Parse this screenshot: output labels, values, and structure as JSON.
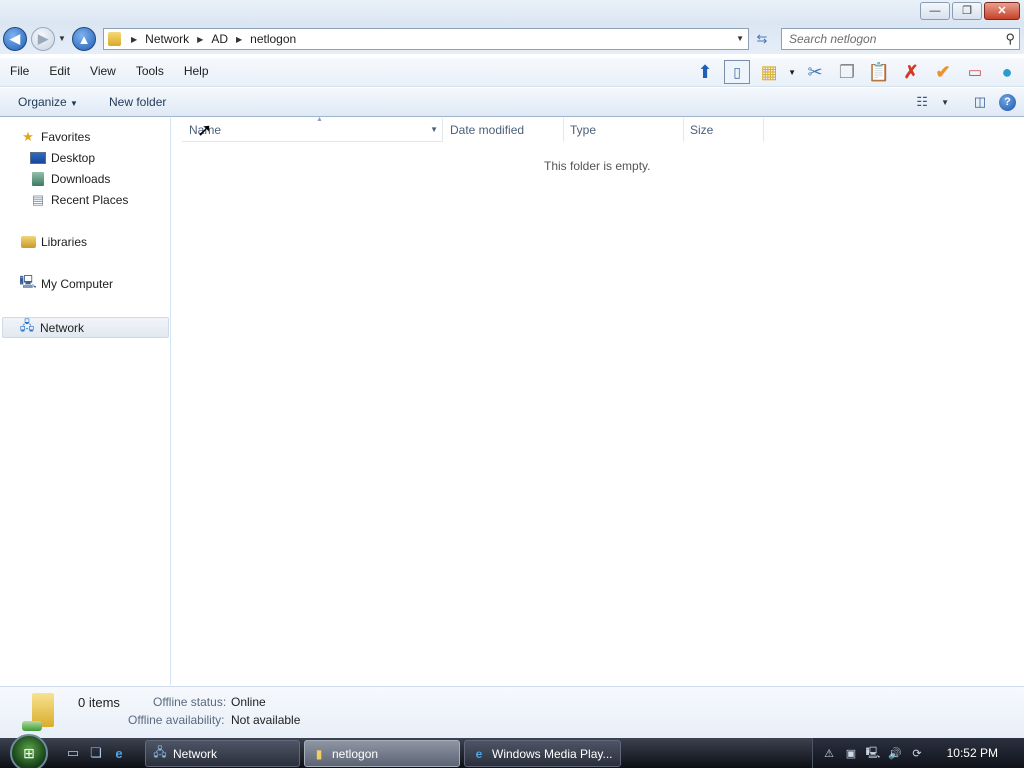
{
  "window": {
    "minimize_glyph": "—",
    "maximize_glyph": "❐",
    "close_glyph": "✕"
  },
  "address": {
    "crumbs": [
      "Network",
      "AD",
      "netlogon"
    ]
  },
  "search": {
    "placeholder": "Search netlogon"
  },
  "menu": {
    "items": [
      "File",
      "Edit",
      "View",
      "Tools",
      "Help"
    ]
  },
  "command_bar": {
    "organize_label": "Organize",
    "new_folder_label": "New folder"
  },
  "nav_pane": {
    "favorites_label": "Favorites",
    "desktop_label": "Desktop",
    "downloads_label": "Downloads",
    "recent_places_label": "Recent Places",
    "libraries_label": "Libraries",
    "my_computer_label": "My Computer",
    "network_label": "Network"
  },
  "columns": {
    "name": "Name",
    "date_modified": "Date modified",
    "type": "Type",
    "size": "Size"
  },
  "content": {
    "empty_message": "This folder is empty."
  },
  "details": {
    "item_count": "0 items",
    "offline_status_label": "Offline status:",
    "offline_status_value": "Online",
    "offline_availability_label": "Offline availability:",
    "offline_availability_value": "Not available"
  },
  "taskbar": {
    "buttons": [
      "Network",
      "netlogon",
      "Windows Media Play..."
    ],
    "clock": "10:52 PM"
  },
  "colors": {
    "accent": "#1f5fb7",
    "taskbar": "#1c2029",
    "selected_nav": "#e2e8f1"
  }
}
